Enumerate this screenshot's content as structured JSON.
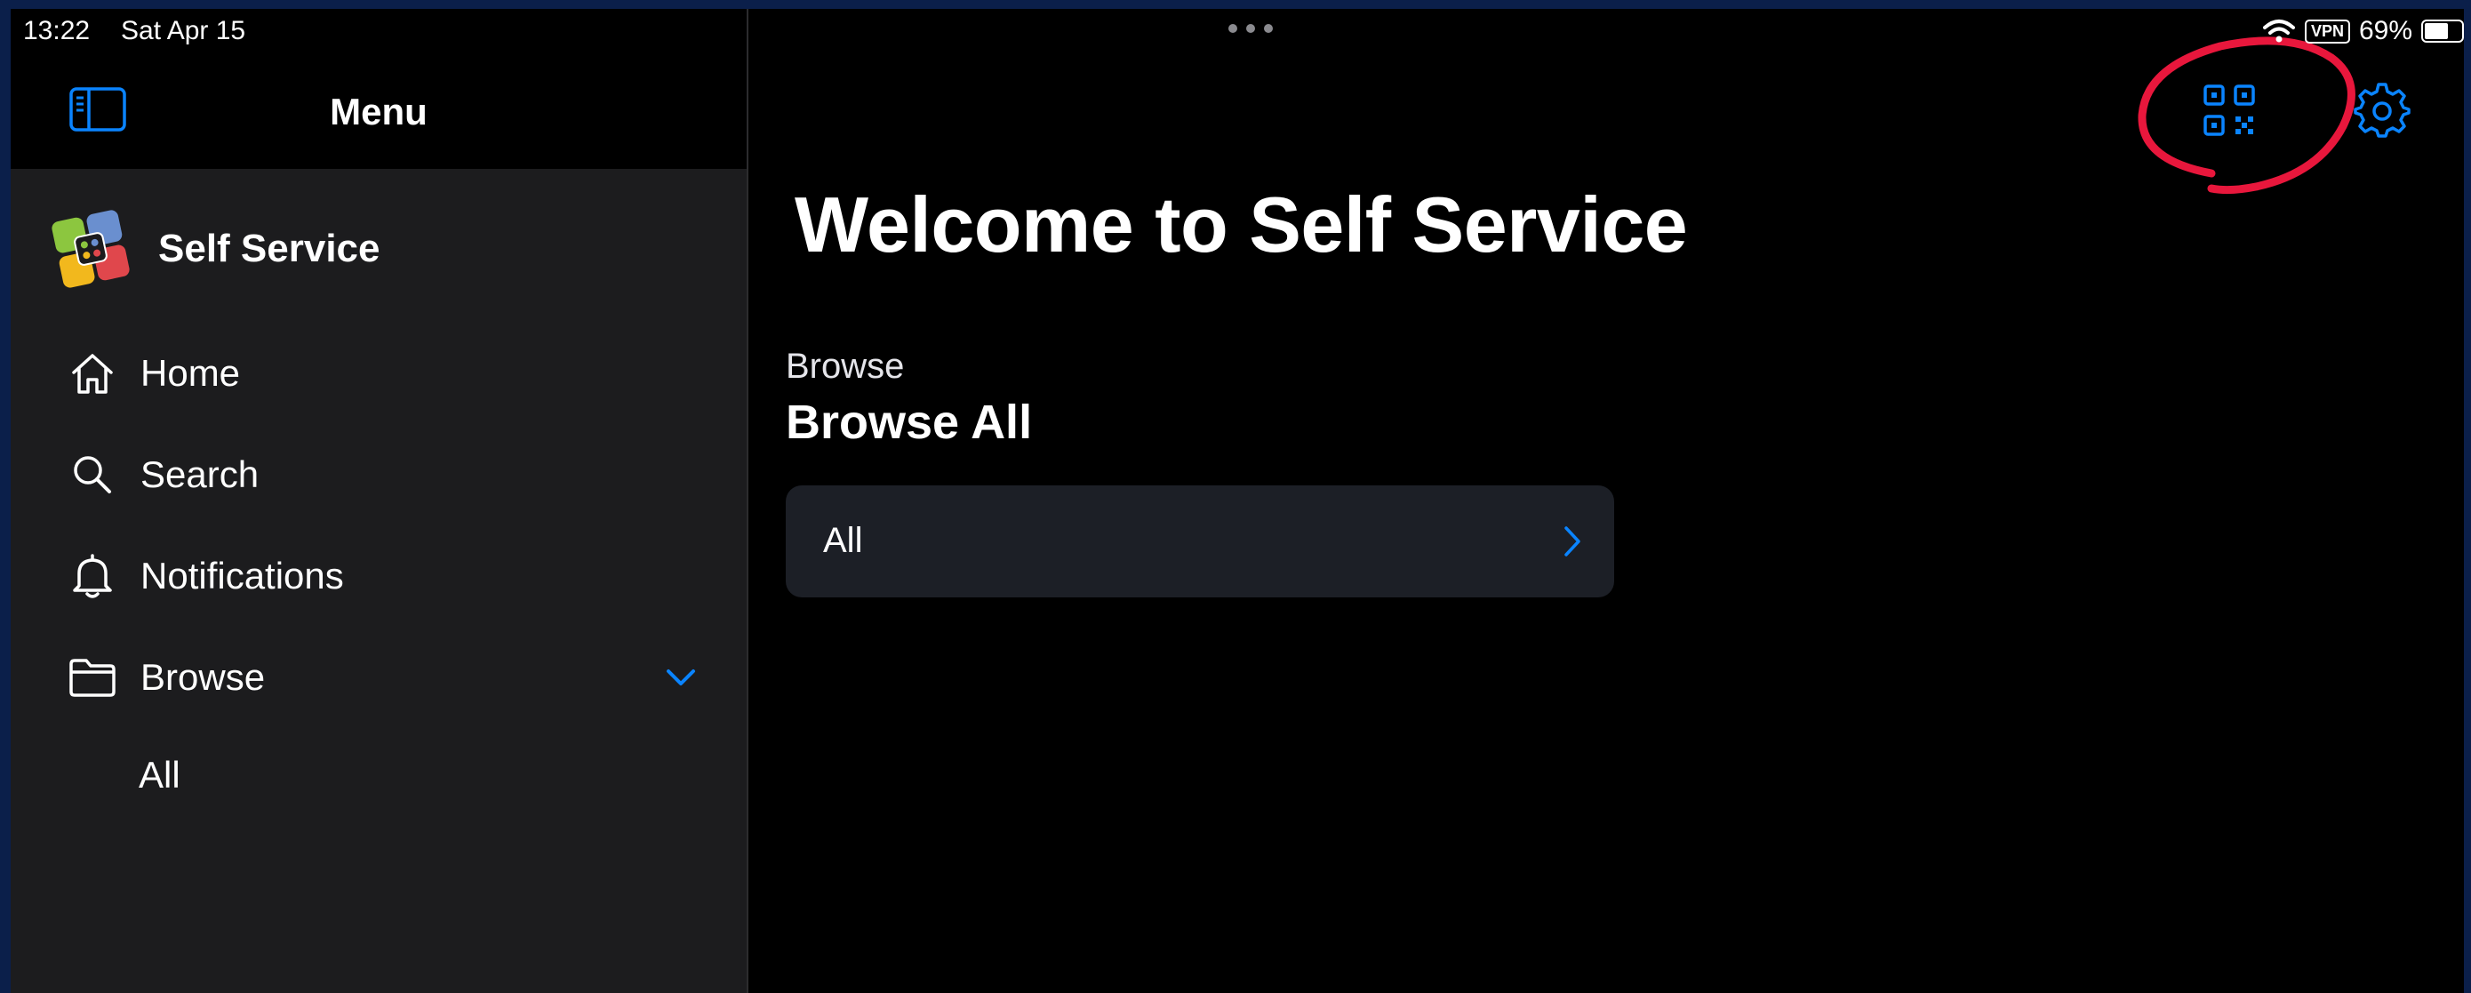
{
  "status_bar": {
    "time": "13:22",
    "date": "Sat Apr 15",
    "vpn": "VPN",
    "battery": "69%",
    "battery_level": 0.69
  },
  "sidebar": {
    "title": "Menu",
    "app_name": "Self Service",
    "items": [
      {
        "label": "Home",
        "icon": "home-icon"
      },
      {
        "label": "Search",
        "icon": "search-icon"
      },
      {
        "label": "Notifications",
        "icon": "bell-icon"
      },
      {
        "label": "Browse",
        "icon": "folder-icon"
      }
    ],
    "browse_subitems": [
      {
        "label": "All"
      }
    ]
  },
  "main": {
    "title": "Welcome to Self Service",
    "section_subtitle": "Browse",
    "section_title": "Browse All",
    "card_label": "All"
  },
  "toolbar": {
    "qr_icon": "qr-code-icon",
    "settings_icon": "gear-icon"
  },
  "colors": {
    "accent": "#0a84ff",
    "annotation": "#e8173c",
    "card": "#1c1f26",
    "sidebar": "#1c1c1e"
  }
}
